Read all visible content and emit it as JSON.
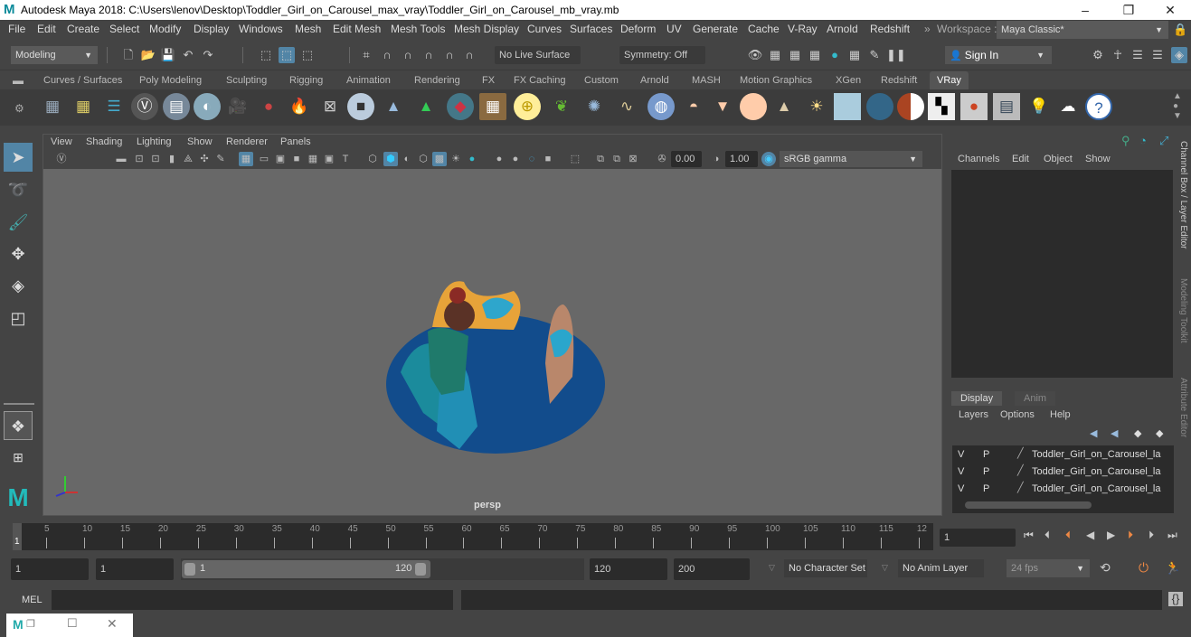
{
  "window": {
    "title": "Autodesk Maya 2018: C:\\Users\\lenov\\Desktop\\Toddler_Girl_on_Carousel_max_vray\\Toddler_Girl_on_Carousel_mb_vray.mb",
    "logo": "M",
    "minimize": "–",
    "maximize": "❐",
    "close": "✕"
  },
  "menubar": {
    "items": [
      "File",
      "Edit",
      "Create",
      "Select",
      "Modify",
      "Display",
      "Windows",
      "Mesh",
      "Edit Mesh",
      "Mesh Tools",
      "Mesh Display",
      "Curves",
      "Surfaces",
      "Deform",
      "UV",
      "Generate",
      "Cache",
      "V-Ray",
      "Arnold",
      "Redshift"
    ],
    "workspace_label": "Workspace :",
    "workspace_value": "Maya Classic*"
  },
  "statusline": {
    "mode": "Modeling",
    "live_surface": "No Live Surface",
    "symmetry": "Symmetry: Off",
    "sign_in": "Sign In"
  },
  "shelf": {
    "tabs": [
      "Curves / Surfaces",
      "Poly Modeling",
      "Sculpting",
      "Rigging",
      "Animation",
      "Rendering",
      "FX",
      "FX Caching",
      "Custom",
      "Arnold",
      "MASH",
      "Motion Graphics",
      "XGen",
      "Redshift",
      "VRay"
    ],
    "active_tab": "VRay",
    "icons": [
      "vray-export-icon",
      "vray-import-icon",
      "vray-settings-list-icon",
      "vray-logo-icon",
      "vray-doc-icon",
      "vray-dome-icon",
      "vray-camera-icon",
      "vray-material-icon",
      "vray-fire-icon",
      "vray-plane-icon",
      "vray-box-icon",
      "vray-cone-sphere-icon",
      "vray-light-mesh-icon",
      "vray-fur-icon",
      "vray-proxy-icon",
      "vray-sphere-light-icon",
      "vray-grass-icon",
      "vray-flake-icon",
      "vray-curve-icon",
      "vray-globe-icon",
      "vray-dome-light-icon",
      "vray-spot-light-icon",
      "vray-omni-light-icon",
      "vray-ies-light-icon",
      "vray-sun-icon",
      "vray-sky-icon",
      "vray-ball-icon",
      "vray-mtl-icon",
      "vray-checker-icon",
      "vray-vfb-icon",
      "vray-table-icon",
      "vray-light-lister-icon",
      "vray-cloud-icon",
      "vray-help-icon"
    ]
  },
  "viewport": {
    "menus": [
      "View",
      "Shading",
      "Lighting",
      "Show",
      "Renderer",
      "Panels"
    ],
    "exposure": "0.00",
    "gamma": "1.00",
    "color_space": "sRGB gamma",
    "camera_label": "persp"
  },
  "channelbox": {
    "menus": [
      "Channels",
      "Edit",
      "Object",
      "Show"
    ]
  },
  "layereditor": {
    "tabs": [
      "Display",
      "Anim"
    ],
    "menus": [
      "Layers",
      "Options",
      "Help"
    ],
    "layers": [
      {
        "v": "V",
        "p": "P",
        "name": "Toddler_Girl_on_Carousel_la"
      },
      {
        "v": "V",
        "p": "P",
        "name": "Toddler_Girl_on_Carousel_la"
      },
      {
        "v": "V",
        "p": "P",
        "name": "Toddler_Girl_on_Carousel_la"
      }
    ]
  },
  "sidetabs": [
    "Channel Box / Layer Editor",
    "Modeling Toolkit",
    "Attribute Editor"
  ],
  "timeslider": {
    "ticks": [
      "5",
      "10",
      "15",
      "20",
      "25",
      "30",
      "35",
      "40",
      "45",
      "50",
      "55",
      "60",
      "65",
      "70",
      "75",
      "80",
      "85",
      "90",
      "95",
      "100",
      "105",
      "110",
      "115",
      "12"
    ],
    "current_marker": "1",
    "current_frame": "1"
  },
  "range": {
    "start": "1",
    "playback_start": "1",
    "slider_min": "1",
    "slider_max": "120",
    "playback_end": "120",
    "end": "200",
    "character_set": "No Character Set",
    "anim_layer": "No Anim Layer",
    "fps": "24 fps"
  },
  "cmdline": {
    "label": "MEL"
  },
  "taskbar": {
    "logo": "M"
  }
}
